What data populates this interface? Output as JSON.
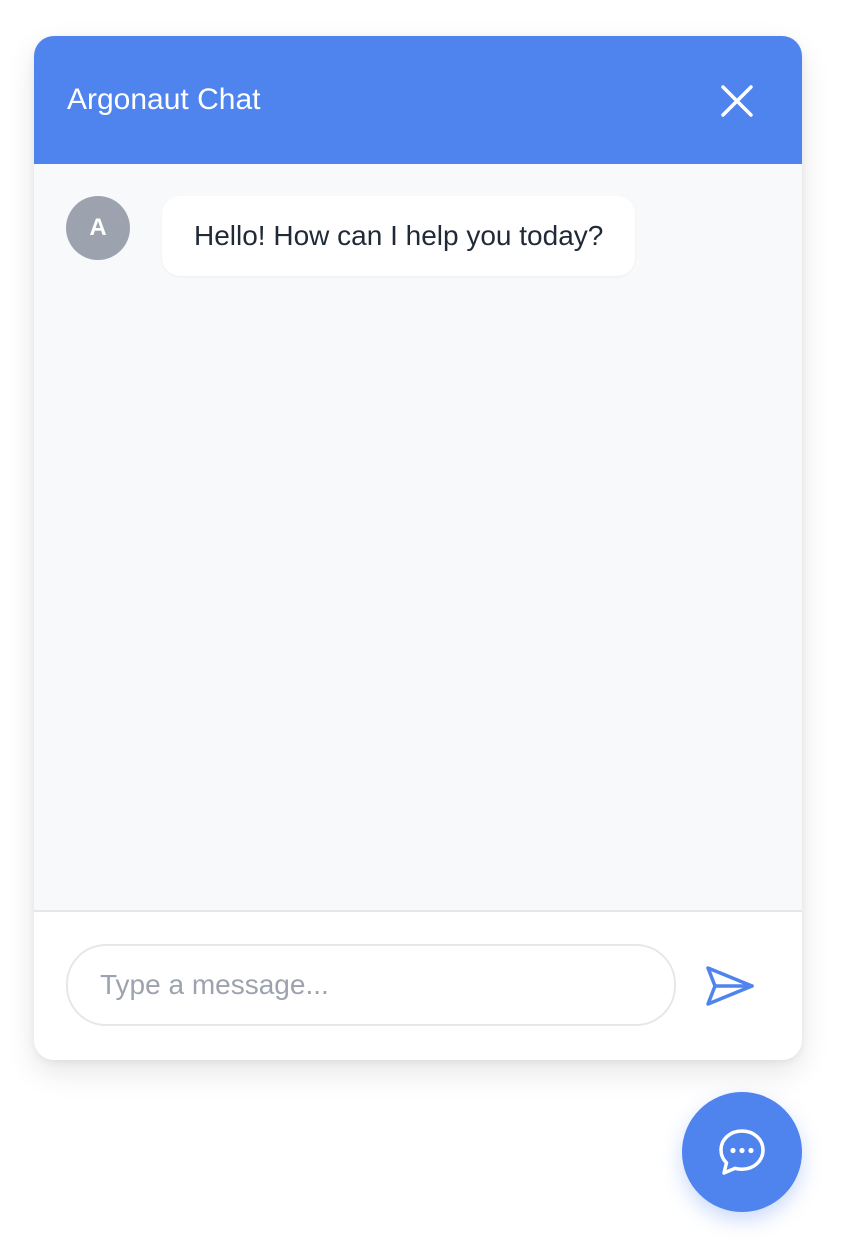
{
  "header": {
    "title": "Argonaut Chat",
    "close_icon": "close-icon",
    "color": "#4f83ee"
  },
  "messages": [
    {
      "avatar_initial": "A",
      "avatar_color": "#9ca3af",
      "text": "Hello! How can I help you today?"
    }
  ],
  "composer": {
    "placeholder": "Type a message...",
    "value": "",
    "send_icon": "send-icon"
  },
  "launcher": {
    "icon": "chat-bubble-icon",
    "color": "#4f83ee"
  }
}
